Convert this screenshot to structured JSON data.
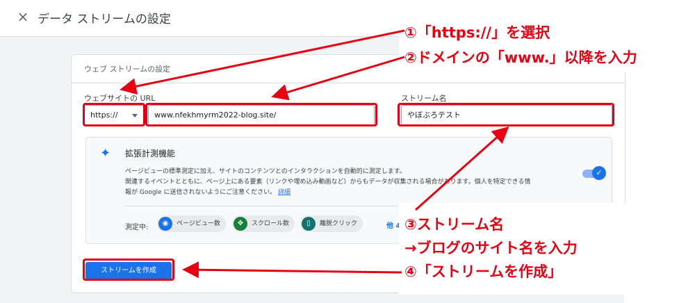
{
  "header": {
    "close_glyph": "×",
    "title": "データ ストリームの設定"
  },
  "card": {
    "title": "ウェブ ストリームの設定",
    "url_label": "ウェブサイトの URL",
    "protocol_value": "https://",
    "url_value": "www.nfekhmyrm2022-blog.site/",
    "stream_name_label": "ストリーム名",
    "stream_name_value": "やぼぶろテスト"
  },
  "enhanced": {
    "title": "拡張計測機能",
    "desc_line1": "ページビューの標準測定に加え、サイトのコンテンツとのインタラクションを自動的に測定します。",
    "desc_line2": "関連するイベントとともに、ページ上にある要素（リンクや埋め込み動画など）からもデータが収集される場合があります。個人を特定できる情",
    "desc_line3": "報が Google に送信されないようにご注意ください。",
    "details_link": "詳細",
    "toggle_on": true,
    "measuring_label": "測定中:",
    "chips": [
      {
        "label": "ページビュー数",
        "icon": "eye-icon",
        "glyph": "◉",
        "color": "#1a73e8"
      },
      {
        "label": "スクロール数",
        "icon": "crosshair-icon",
        "glyph": "✥",
        "color": "#188038"
      },
      {
        "label": "離脱クリック",
        "icon": "mouse-icon",
        "glyph": "▯",
        "color": "#12736e"
      }
    ],
    "more_link": "他 4 個"
  },
  "create_button": "ストリームを作成",
  "annotations": {
    "a1": "①「https://」を選択",
    "a2": "②ドメインの「www.」以降を入力",
    "a3_line1": "③ストリーム名",
    "a3_line2": "→ブログのサイト名を入力",
    "a4": "④「ストリームを作成」",
    "color": "#e60012"
  }
}
